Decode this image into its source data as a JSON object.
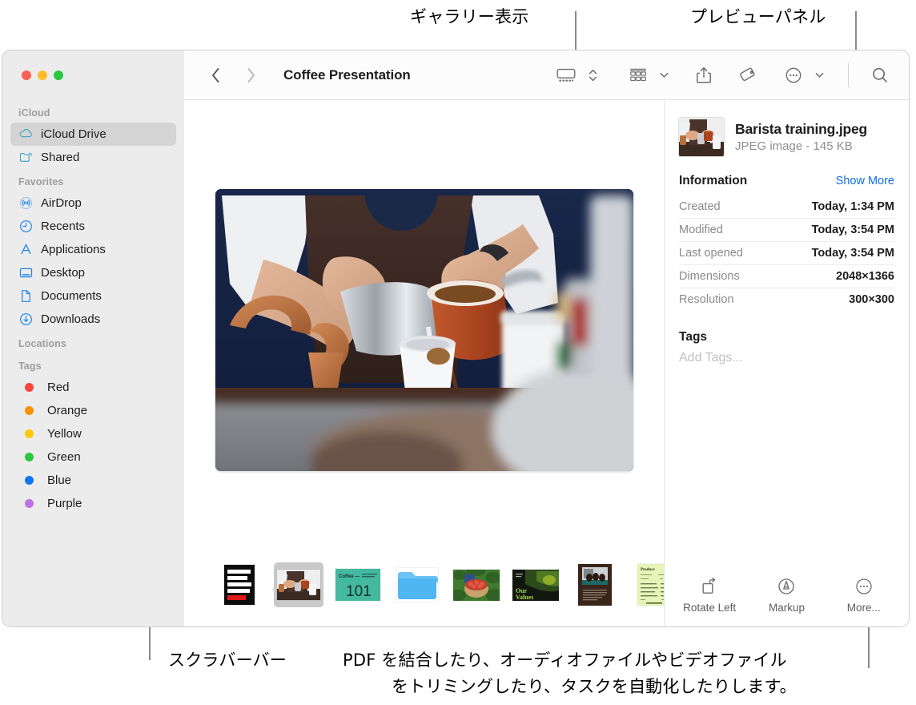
{
  "annotations": {
    "gallery_view": "ギャラリー表示",
    "preview_panel": "プレビューパネル",
    "scrubber_bar": "スクラバーバー",
    "quick_actions_line1": "PDF を結合したり、オーディオファイルやビデオファイル",
    "quick_actions_line2": "をトリミングしたり、タスクを自動化したりします。"
  },
  "window": {
    "traffic_lights": [
      "close",
      "minimize",
      "zoom"
    ],
    "colors": {
      "close": "#fc5f57",
      "minimize": "#fdbc2e",
      "zoom": "#28c840",
      "accent": "#0a6fe8"
    }
  },
  "sidebar": {
    "sections": [
      {
        "header": "iCloud",
        "items": [
          {
            "label": "iCloud Drive",
            "icon": "cloud-icon",
            "selected": true
          },
          {
            "label": "Shared",
            "icon": "shared-folder-icon",
            "selected": false
          }
        ]
      },
      {
        "header": "Favorites",
        "items": [
          {
            "label": "AirDrop",
            "icon": "airdrop-icon",
            "selected": false
          },
          {
            "label": "Recents",
            "icon": "clock-icon",
            "selected": false
          },
          {
            "label": "Applications",
            "icon": "applications-icon",
            "selected": false
          },
          {
            "label": "Desktop",
            "icon": "desktop-icon",
            "selected": false
          },
          {
            "label": "Documents",
            "icon": "document-icon",
            "selected": false
          },
          {
            "label": "Downloads",
            "icon": "downloads-icon",
            "selected": false
          }
        ]
      },
      {
        "header": "Locations",
        "items": []
      },
      {
        "header": "Tags",
        "items": [
          {
            "label": "Red",
            "icon": "tag-dot-icon",
            "color": "#f9443a"
          },
          {
            "label": "Orange",
            "icon": "tag-dot-icon",
            "color": "#f99000"
          },
          {
            "label": "Yellow",
            "icon": "tag-dot-icon",
            "color": "#fdc70b"
          },
          {
            "label": "Green",
            "icon": "tag-dot-icon",
            "color": "#2ac73f"
          },
          {
            "label": "Blue",
            "icon": "tag-dot-icon",
            "color": "#0c79f2"
          },
          {
            "label": "Purple",
            "icon": "tag-dot-icon",
            "color": "#bd73e3"
          }
        ]
      }
    ]
  },
  "toolbar": {
    "back": "back-chevron",
    "forward": "forward-chevron",
    "title": "Coffee Presentation",
    "view_mode": "gallery-view-icon",
    "view_stepper": "up-down-chevron",
    "group_by": "group-by-icon",
    "group_by_chevron": "chevron-down",
    "share": "share-icon",
    "tag": "tag-icon",
    "more": "more-circle-icon",
    "more_chevron": "chevron-down",
    "search": "search-icon"
  },
  "gallery": {
    "hero_alt": "barista-pouring-coffee",
    "thumbnails": [
      {
        "name": "Growing Picking Roasting Brewing Coffee poster",
        "kind": "poster",
        "selected": false
      },
      {
        "name": "Barista training.jpeg",
        "kind": "photo",
        "selected": true
      },
      {
        "name": "Coffee 101 slide",
        "kind": "slide",
        "selected": false
      },
      {
        "name": "Folder",
        "kind": "folder",
        "selected": false
      },
      {
        "name": "Coffee cherries photo",
        "kind": "photo",
        "selected": false
      },
      {
        "name": "Our Values slide",
        "kind": "slide",
        "selected": false
      },
      {
        "name": "Team meeting document",
        "kind": "document",
        "selected": false
      },
      {
        "name": "Produce invoice",
        "kind": "document",
        "selected": false
      }
    ]
  },
  "preview_panel": {
    "file_name": "Barista training.jpeg",
    "file_kind": "JPEG image - 145 KB",
    "information": {
      "title": "Information",
      "action": "Show More",
      "rows": [
        {
          "key": "Created",
          "value": "Today, 1:34 PM"
        },
        {
          "key": "Modified",
          "value": "Today, 3:54 PM"
        },
        {
          "key": "Last opened",
          "value": "Today, 3:54 PM"
        },
        {
          "key": "Dimensions",
          "value": "2048×1366"
        },
        {
          "key": "Resolution",
          "value": "300×300"
        }
      ]
    },
    "tags": {
      "title": "Tags",
      "placeholder": "Add Tags..."
    },
    "quick_actions": [
      {
        "label": "Rotate Left",
        "icon": "rotate-left-icon"
      },
      {
        "label": "Markup",
        "icon": "markup-icon"
      },
      {
        "label": "More...",
        "icon": "more-circle-icon"
      }
    ]
  }
}
